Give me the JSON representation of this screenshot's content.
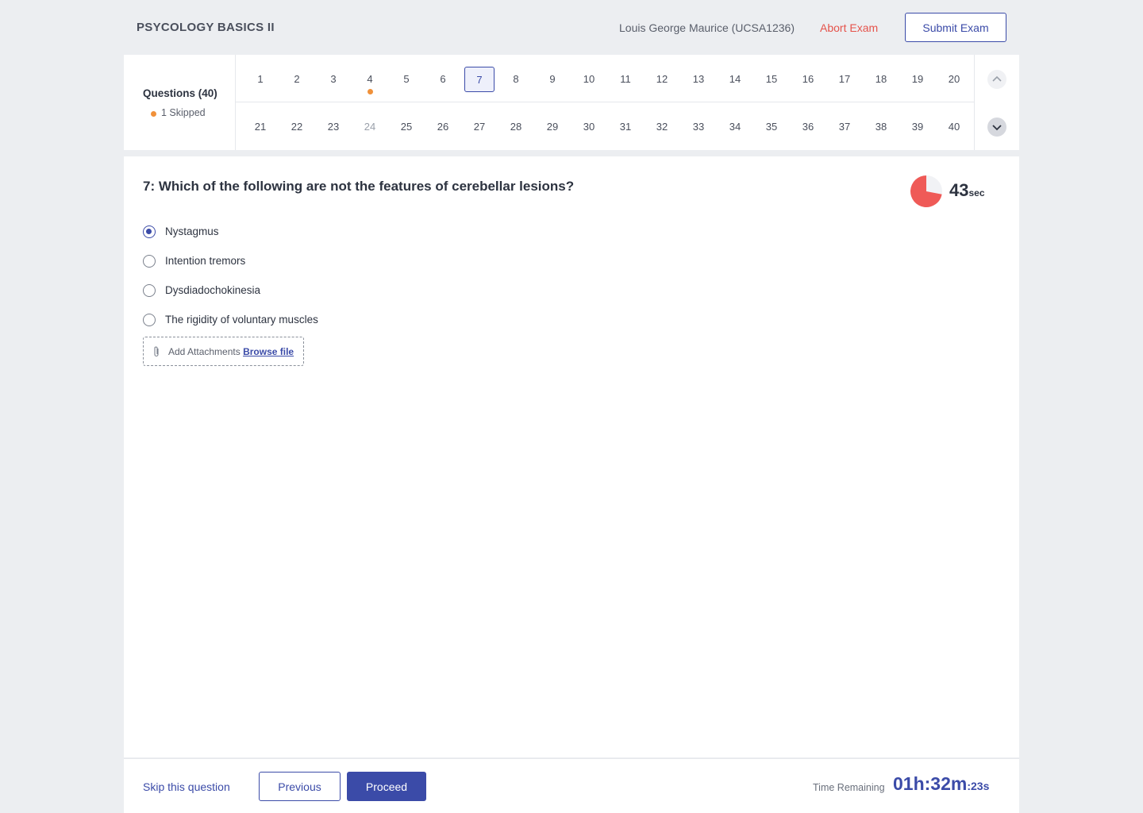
{
  "header": {
    "exam_title": "PSYCOLOGY BASICS II",
    "student": "Louis George Maurice (UCSA1236)",
    "abort_label": "Abort Exam",
    "submit_label": "Submit Exam"
  },
  "navigator": {
    "questions_label": "Questions (40)",
    "skipped_label": "1 Skipped",
    "active_question": "7",
    "skipped_question": "4",
    "row1": [
      "1",
      "2",
      "3",
      "4",
      "5",
      "6",
      "7",
      "8",
      "9",
      "10",
      "11",
      "12",
      "13",
      "14",
      "15",
      "16",
      "17",
      "18",
      "19",
      "20"
    ],
    "row2": [
      "21",
      "22",
      "23",
      "24",
      "25",
      "26",
      "27",
      "28",
      "29",
      "30",
      "31",
      "32",
      "33",
      "34",
      "35",
      "36",
      "37",
      "38",
      "39",
      "40"
    ],
    "dim_question": "24"
  },
  "question": {
    "title": "7: Which of the following are not the features of cerebellar lesions?",
    "timer_value": "43",
    "timer_unit": "sec",
    "timer_fraction": 0.72,
    "options": [
      "Nystagmus",
      "Intention tremors",
      "Dysdiadochokinesia",
      "The rigidity of voluntary muscles"
    ],
    "selected_index": 0,
    "attach_label": "Add Attachments",
    "browse_label": "Browse file"
  },
  "footer": {
    "skip_label": "Skip this question",
    "previous_label": "Previous",
    "proceed_label": "Proceed",
    "time_label": "Time Remaining",
    "time_main": "01h:32m",
    "time_seconds": ":23s"
  },
  "colors": {
    "accent": "#3b4ba8",
    "danger": "#e5534b",
    "skipped": "#f0913a"
  }
}
